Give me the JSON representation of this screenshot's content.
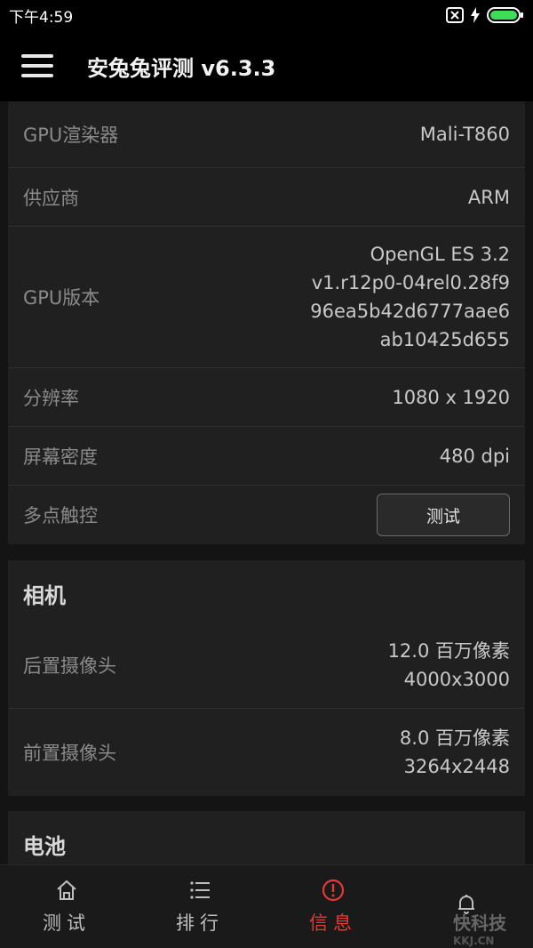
{
  "status_bar": {
    "time": "下午4:59"
  },
  "app_bar": {
    "title": "安兔兔评测 v6.3.3"
  },
  "display_card": {
    "rows": [
      {
        "label": "GPU渲染器",
        "value": "Mali-T860"
      },
      {
        "label": "供应商",
        "value": "ARM"
      },
      {
        "label": "GPU版本",
        "value_lines": [
          "OpenGL ES 3.2",
          "v1.r12p0-04rel0.28f9",
          "96ea5b42d6777aae6",
          "ab10425d655"
        ]
      },
      {
        "label": "分辨率",
        "value": "1080 x 1920"
      },
      {
        "label": "屏幕密度",
        "value": "480 dpi"
      },
      {
        "label": "多点触控",
        "button_label": "测试"
      }
    ]
  },
  "camera_card": {
    "title": "相机",
    "rows": [
      {
        "label": "后置摄像头",
        "value_lines": [
          "12.0 百万像素",
          "4000x3000"
        ]
      },
      {
        "label": "前置摄像头",
        "value_lines": [
          "8.0 百万像素",
          "3264x2448"
        ]
      }
    ]
  },
  "battery_card": {
    "title": "电池"
  },
  "bottom_nav": {
    "items": [
      {
        "label": "测试",
        "icon": "home-icon",
        "active": false
      },
      {
        "label": "排行",
        "icon": "list-icon",
        "active": false
      },
      {
        "label": "信息",
        "icon": "info-alert-icon",
        "active": true
      },
      {
        "label": "",
        "icon": "bell-icon",
        "active": false
      }
    ]
  },
  "watermark": {
    "line1": "快科技",
    "line2": "KKJ.CN"
  },
  "colors": {
    "accent": "#e53935",
    "background": "#141414",
    "card": "#202020"
  }
}
